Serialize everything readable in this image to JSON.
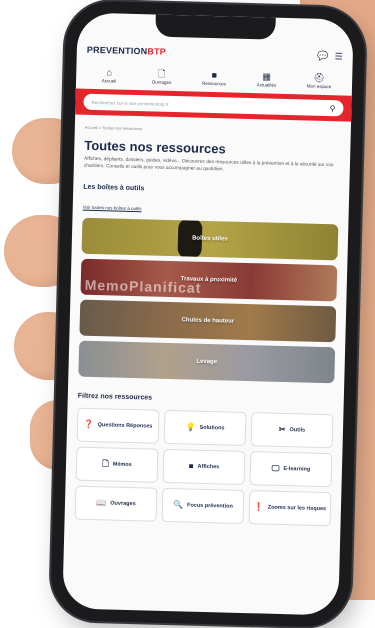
{
  "header": {
    "logo_main": "PREVENTION",
    "logo_accent": "BTP"
  },
  "nav": [
    {
      "icon": "home-icon",
      "glyph": "⌂",
      "label": "Accueil"
    },
    {
      "icon": "document-icon",
      "glyph": "🗋",
      "label": "Ouvrages"
    },
    {
      "icon": "book-icon",
      "glyph": "■",
      "label": "Ressources"
    },
    {
      "icon": "grid-icon",
      "glyph": "▦",
      "label": "Actualités"
    },
    {
      "icon": "helmet-icon",
      "glyph": "⛑",
      "label": "Mon espace"
    }
  ],
  "search": {
    "placeholder": "Recherchez sur le site preventionbtp.fr"
  },
  "breadcrumb": "Accueil > Toutes nos ressources",
  "page": {
    "title": "Toutes nos ressources",
    "intro": "Affiches, dépliants, dossiers, guides, vidéos... Découvrez des ressources utiles à la prévention et à la sécurité sur vos chantiers. Conseils et outils pour vous accompagner au quotidien."
  },
  "toolbox": {
    "title": "Les boîtes à outils",
    "link": "Voir toutes nos boîtes à outils",
    "cards": [
      {
        "label": "Boîtes utiles"
      },
      {
        "label": "Travaux à proximité",
        "overlay": "MemoPlanificat"
      },
      {
        "label": "Chutes de hauteur"
      },
      {
        "label": "Levage"
      }
    ]
  },
  "filters": {
    "title": "Filtrez nos ressources",
    "items": [
      {
        "icon": "question-icon",
        "glyph": "❓",
        "label": "Questions Réponses"
      },
      {
        "icon": "lightbulb-icon",
        "glyph": "💡",
        "label": "Solutions"
      },
      {
        "icon": "tools-icon",
        "glyph": "✂",
        "label": "Outils"
      },
      {
        "icon": "memo-icon",
        "glyph": "🗋",
        "label": "Mémos"
      },
      {
        "icon": "poster-icon",
        "glyph": "■",
        "label": "Affiches"
      },
      {
        "icon": "monitor-icon",
        "glyph": "🖵",
        "label": "E-learning"
      },
      {
        "icon": "book-icon",
        "glyph": "📖",
        "label": "Ouvrages"
      },
      {
        "icon": "search-icon",
        "glyph": "🔍",
        "label": "Focus prévention"
      },
      {
        "icon": "info-icon",
        "glyph": "❗",
        "label": "Zooms sur les risques"
      }
    ]
  },
  "colors": {
    "brand_red": "#e4262c",
    "navy": "#1d2a4a"
  }
}
